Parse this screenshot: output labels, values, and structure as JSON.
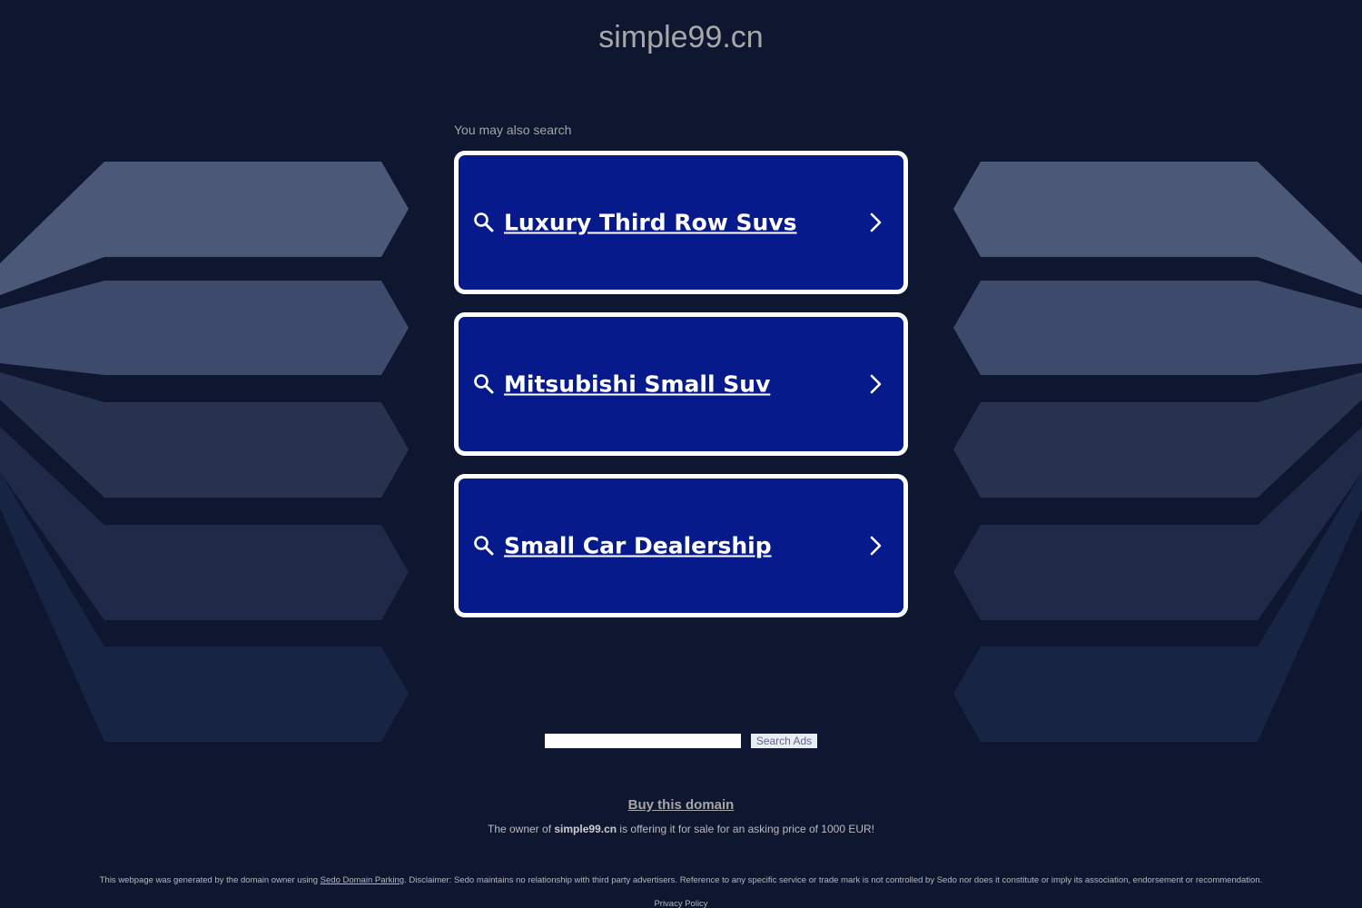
{
  "header": {
    "domain": "simple99.cn"
  },
  "related": {
    "heading": "You may also search",
    "items": [
      {
        "label": "Luxury Third Row Suvs"
      },
      {
        "label": "Mitsubishi Small Suv"
      },
      {
        "label": "Small Car Dealership"
      }
    ]
  },
  "search": {
    "input_value": "",
    "button_label": "Search Ads"
  },
  "sale": {
    "buy_link": "Buy this domain",
    "owner_prefix": "The owner of",
    "owner_domain": "simple99.cn",
    "owner_suffix": "is offering it for sale for an asking price of 1000 EUR!"
  },
  "footer": {
    "generated_prefix": "This webpage was generated by the domain owner using",
    "sedo_link": "Sedo Domain Parking",
    "disclaimer_rest": ". Disclaimer: Sedo maintains no relationship with third party advertisers. Reference to any specific service or trade mark is not controlled by Sedo nor does it constitute or imply its association, endorsement or recommendation.",
    "privacy_link": "Privacy Policy"
  },
  "colors": {
    "background": "#0e1630",
    "card": "#061a8c",
    "card_border": "#ffffff"
  },
  "icons": [
    "search-icon",
    "chevron-right-icon"
  ]
}
